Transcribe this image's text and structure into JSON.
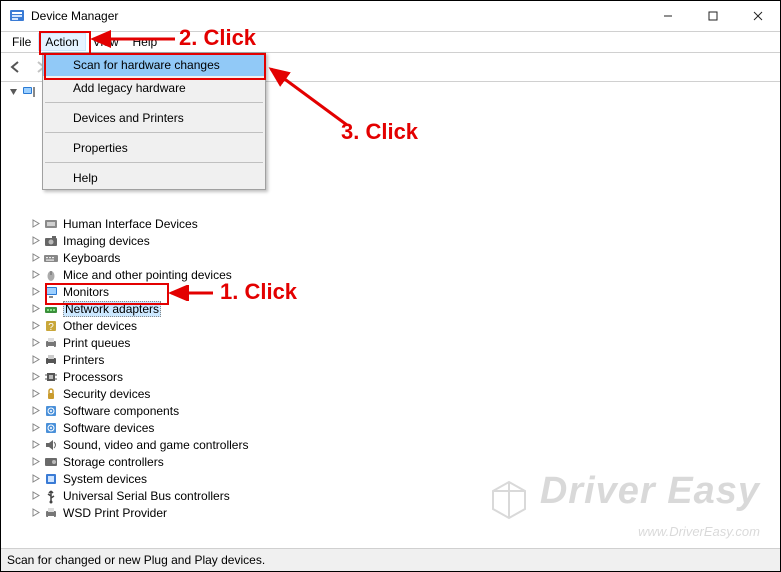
{
  "window": {
    "title": "Device Manager"
  },
  "menubar": {
    "items": [
      "File",
      "Action",
      "View",
      "Help"
    ],
    "selected_index": 1
  },
  "dropdown": {
    "items": [
      "Scan for hardware changes",
      "Add legacy hardware",
      "Devices and Printers",
      "Properties",
      "Help"
    ],
    "highlight_index": 0
  },
  "tree": {
    "root": "desktop-root",
    "children": [
      {
        "label": "Human Interface Devices",
        "icon": "hid"
      },
      {
        "label": "Imaging devices",
        "icon": "camera"
      },
      {
        "label": "Keyboards",
        "icon": "keyboard"
      },
      {
        "label": "Mice and other pointing devices",
        "icon": "mouse"
      },
      {
        "label": "Monitors",
        "icon": "monitor"
      },
      {
        "label": "Network adapters",
        "icon": "network",
        "selected": true
      },
      {
        "label": "Other devices",
        "icon": "other"
      },
      {
        "label": "Print queues",
        "icon": "printq"
      },
      {
        "label": "Printers",
        "icon": "printer"
      },
      {
        "label": "Processors",
        "icon": "cpu"
      },
      {
        "label": "Security devices",
        "icon": "security"
      },
      {
        "label": "Software components",
        "icon": "sw"
      },
      {
        "label": "Software devices",
        "icon": "sw"
      },
      {
        "label": "Sound, video and game controllers",
        "icon": "sound"
      },
      {
        "label": "Storage controllers",
        "icon": "storage"
      },
      {
        "label": "System devices",
        "icon": "system"
      },
      {
        "label": "Universal Serial Bus controllers",
        "icon": "usb"
      },
      {
        "label": "WSD Print Provider",
        "icon": "printq"
      }
    ]
  },
  "statusbar": {
    "text": "Scan for changed or new Plug and Play devices."
  },
  "annotations": {
    "step1": "1. Click",
    "step2": "2. Click",
    "step3": "3. Click"
  },
  "watermark": {
    "brand": "Driver Easy",
    "url": "www.DriverEasy.com"
  },
  "colors": {
    "annotation": "#e30000",
    "highlight": "#91c9f7",
    "selection": "#cce8ff"
  }
}
